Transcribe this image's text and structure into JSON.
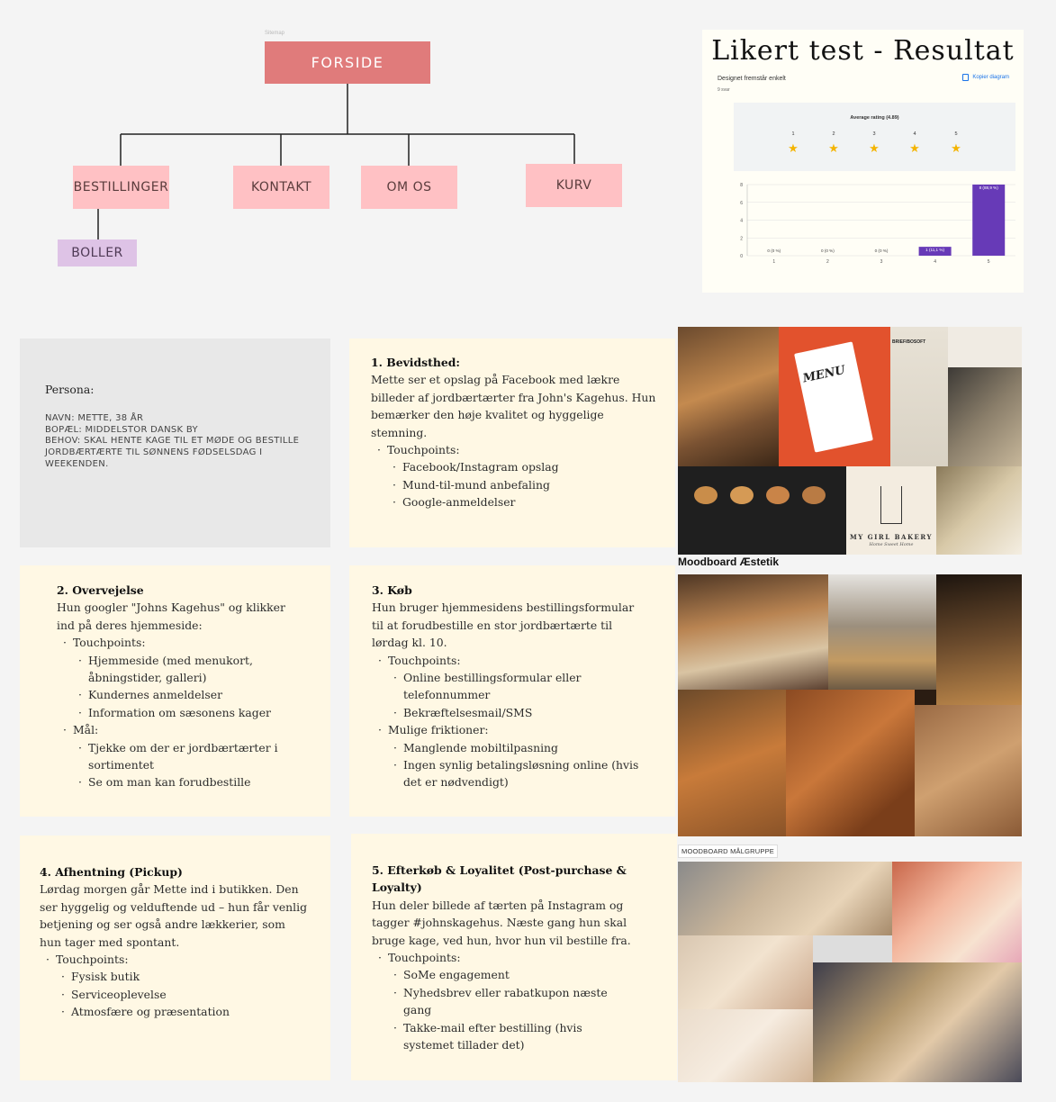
{
  "sitemap": {
    "caption": "Sitemap",
    "root": "FORSIDE",
    "children": [
      "BESTILLINGER",
      "KONTAKT",
      "OM OS",
      "KURV"
    ],
    "sub": "BOLLER"
  },
  "likert": {
    "title": "Likert test - Resultat",
    "question": "Designet fremstår enkelt",
    "responses": "9 svar",
    "copy_label": "Kopier diagram",
    "average_label": "Average rating (4.89)",
    "rating_scale": [
      "1",
      "2",
      "3",
      "4",
      "5"
    ],
    "icons": {
      "copy": "copy-icon",
      "star": "star-icon"
    },
    "star_color": "#f4b400"
  },
  "chart_data": {
    "type": "bar",
    "categories": [
      "1",
      "2",
      "3",
      "4",
      "5"
    ],
    "values": [
      0,
      0,
      0,
      1,
      8
    ],
    "data_labels": [
      "0 (0 %)",
      "0 (0 %)",
      "0 (0 %)",
      "1 (11,1 %)",
      "8 (88,9 %)"
    ],
    "y_ticks": [
      "0",
      "2",
      "4",
      "6",
      "8"
    ],
    "ylim": [
      0,
      8
    ],
    "bar_color": "#673ab7",
    "grid": true,
    "legend": "none"
  },
  "persona": {
    "heading": "Persona:",
    "lines": [
      "Navn: Mette, 38 år",
      "Bopæl: Middelstor dansk by",
      "Behov: Skal hente kage til et møde og bestille jordbærtærte til sønnens fødselsdag i weekenden."
    ]
  },
  "cards": {
    "c1": {
      "title": "1. Bevidsthed:",
      "body": "Mette ser et opslag på Facebook med lækre billeder af jordbærtærter fra John's Kagehus. Hun bemærker den høje kvalitet og hyggelige stemning.",
      "touch_label": "Touchpoints:",
      "touch": [
        "Facebook/Instagram opslag",
        "Mund-til-mund anbefaling",
        "Google-anmeldelser"
      ]
    },
    "c2": {
      "title": "2. Overvejelse",
      "body": "Hun googler \"Johns Kagehus\" og klikker ind på deres hjemmeside:",
      "touch_label": "Touchpoints:",
      "touch": [
        "Hjemmeside (med menukort, åbningstider, galleri)",
        "Kundernes anmeldelser",
        "Information om sæsonens kager"
      ],
      "goal_label": "Mål:",
      "goals": [
        "Tjekke om der er jordbærtærter i sortimentet",
        "Se om man kan forudbestille"
      ]
    },
    "c3": {
      "title": "3. Køb",
      "body": "Hun bruger hjemmesidens bestillingsformular til at forudbestille en stor jordbærtærte til lørdag kl. 10.",
      "touch_label": "Touchpoints:",
      "touch": [
        "Online bestillingsformular eller telefonnummer",
        "Bekræftelsesmail/SMS"
      ],
      "friction_label": "Mulige friktioner:",
      "frictions": [
        "Manglende mobiltilpasning",
        "Ingen synlig betalingsløsning online (hvis det er nødvendigt)"
      ]
    },
    "c4": {
      "title": "4. Afhentning (Pickup)",
      "body": "Lørdag morgen går Mette ind i butikken. Den ser hyggelig og velduftende ud – hun får venlig betjening og ser også andre lækkerier, som hun tager med spontant.",
      "touch_label": "Touchpoints:",
      "touch": [
        "Fysisk butik",
        "Serviceoplevelse",
        "Atmosfære og præsentation"
      ]
    },
    "c5": {
      "title": "5. Efterkøb & Loyalitet (Post-purchase & Loyalty)",
      "body": "Hun deler billede af tærten på Instagram og tagger #johnskagehus. Næste gang hun skal bruge kage, ved hun, hvor hun vil bestille fra.",
      "touch_label": "Touchpoints:",
      "touch": [
        "SoMe engagement",
        "Nyhedsbrev eller rabatkupon næste gang",
        "Takke-mail efter bestilling (hvis systemet tillader det)"
      ]
    }
  },
  "moodboards": {
    "aesthetic_label": "Moodboard Æstetik",
    "target_label": "MOODBOARD MÅLGRUPPE",
    "menu_text": "MENU",
    "bakery_sign": "MY GIRL BAKERY",
    "bakery_sub": "Home Sweet Home",
    "brief_text": "BRIEF/BOSOFT"
  }
}
